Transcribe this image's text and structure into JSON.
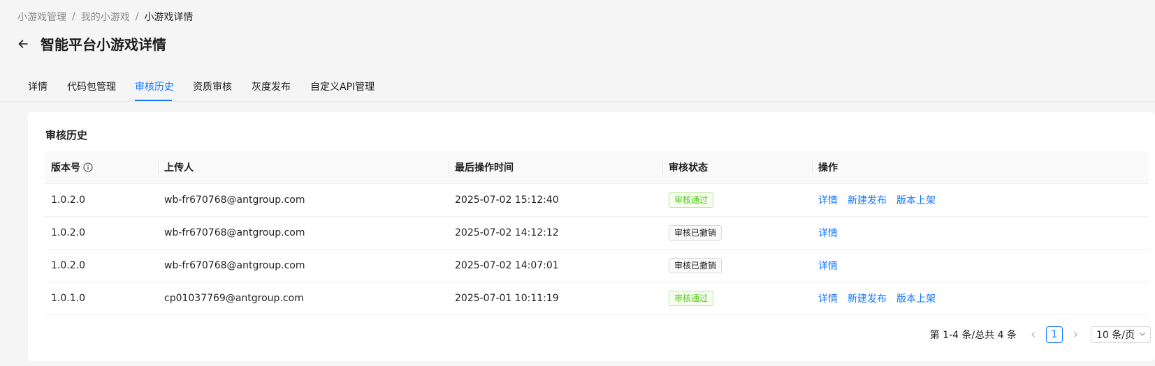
{
  "breadcrumb": {
    "items": [
      "小游戏管理",
      "我的小游戏",
      "小游戏详情"
    ],
    "separator": "/"
  },
  "header": {
    "title": "智能平台小游戏详情"
  },
  "tabs": [
    {
      "label": "详情"
    },
    {
      "label": "代码包管理"
    },
    {
      "label": "审核历史",
      "active": true
    },
    {
      "label": "资质审核"
    },
    {
      "label": "灰度发布"
    },
    {
      "label": "自定义API管理"
    }
  ],
  "card": {
    "title": "审核历史"
  },
  "table": {
    "columns": [
      "版本号",
      "上传人",
      "最后操作时间",
      "审核状态",
      "操作"
    ],
    "rows": [
      {
        "version": "1.0.2.0",
        "uploader": "wb-fr670768@antgroup.com",
        "time": "2025-07-02 15:12:40",
        "status": "审核通过",
        "status_type": "pass",
        "actions": [
          "详情",
          "新建发布",
          "版本上架"
        ]
      },
      {
        "version": "1.0.2.0",
        "uploader": "wb-fr670768@antgroup.com",
        "time": "2025-07-02 14:12:12",
        "status": "审核已撤销",
        "status_type": "revoked",
        "actions": [
          "详情"
        ]
      },
      {
        "version": "1.0.2.0",
        "uploader": "wb-fr670768@antgroup.com",
        "time": "2025-07-02 14:07:01",
        "status": "审核已撤销",
        "status_type": "revoked",
        "actions": [
          "详情"
        ]
      },
      {
        "version": "1.0.1.0",
        "uploader": "cp01037769@antgroup.com",
        "time": "2025-07-01 10:11:19",
        "status": "审核通过",
        "status_type": "pass",
        "actions": [
          "详情",
          "新建发布",
          "版本上架"
        ]
      }
    ]
  },
  "pagination": {
    "total_text": "第 1-4 条/总共 4 条",
    "current_page": "1",
    "page_size": "10 条/页"
  },
  "colors": {
    "primary": "#1677ff",
    "success": "#52c41a",
    "background": "#f5f5f5"
  },
  "icons": [
    "arrow-left-icon",
    "info-circle-icon",
    "chevron-left-icon",
    "chevron-right-icon",
    "chevron-down-icon"
  ]
}
